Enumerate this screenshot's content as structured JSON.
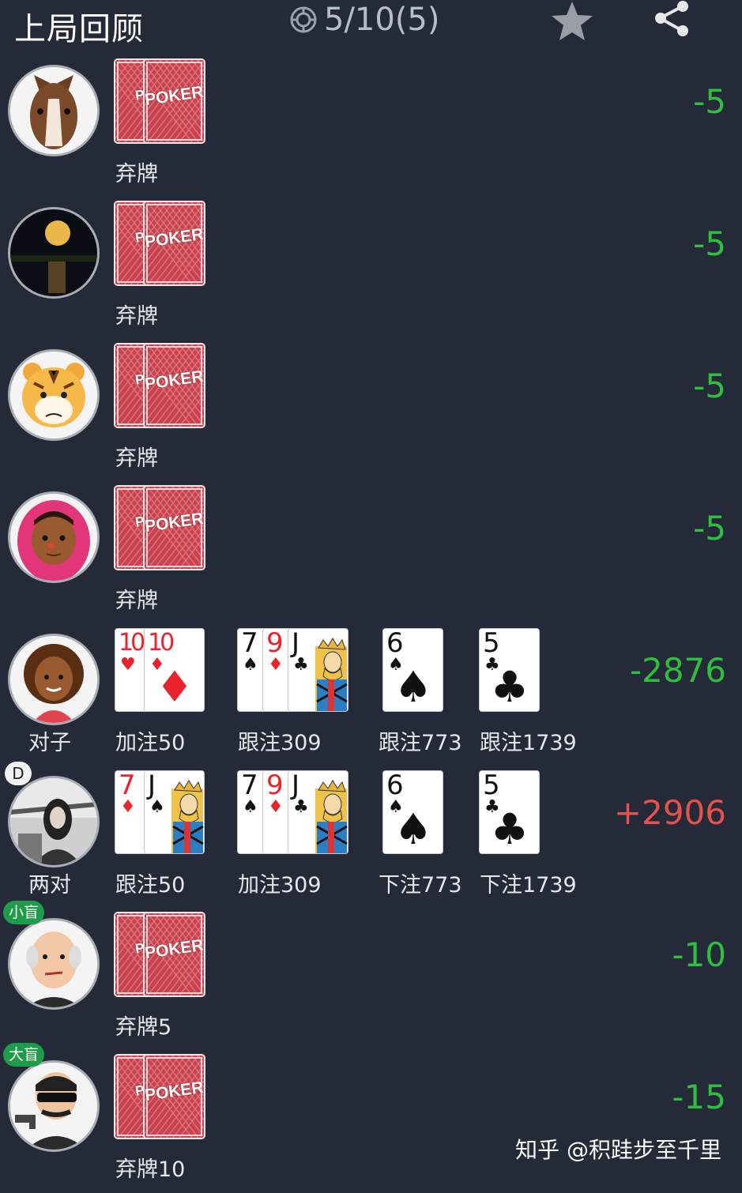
{
  "header": {
    "title": "上局回顾",
    "stakes": "5/10(5)",
    "icons": {
      "chip": "chip-icon",
      "star": "star-icon",
      "share": "share-icon"
    }
  },
  "colors": {
    "background": "#242a38",
    "win": "#e5514b",
    "loss": "#2fbf3f",
    "badge_green": "#1e9c4a"
  },
  "card_back_text": {
    "small": "PO",
    "big": "POKER"
  },
  "players": [
    {
      "avatar": "horse-avatar",
      "badge": "",
      "hand": "",
      "result": "-5",
      "sign": "neg",
      "streets": [
        {
          "type": "back",
          "action": "弃牌"
        }
      ]
    },
    {
      "avatar": "moon-avatar",
      "badge": "",
      "hand": "",
      "result": "-5",
      "sign": "neg",
      "streets": [
        {
          "type": "back",
          "action": "弃牌"
        }
      ]
    },
    {
      "avatar": "tiger-avatar",
      "badge": "",
      "hand": "",
      "result": "-5",
      "sign": "neg",
      "streets": [
        {
          "type": "back",
          "action": "弃牌"
        }
      ]
    },
    {
      "avatar": "hijab-girl-avatar",
      "badge": "",
      "hand": "",
      "result": "-5",
      "sign": "neg",
      "streets": [
        {
          "type": "back",
          "action": "弃牌"
        }
      ]
    },
    {
      "avatar": "curly-woman-avatar",
      "badge": "",
      "hand": "对子",
      "result": "-2876",
      "sign": "neg",
      "streets": [
        {
          "type": "hole",
          "action": "加注50",
          "cards": [
            {
              "rank": "10",
              "suit": "♥",
              "color": "red"
            },
            {
              "rank": "10",
              "suit": "♦",
              "color": "red"
            }
          ]
        },
        {
          "type": "flop",
          "action": "跟注309",
          "cards": [
            {
              "rank": "7",
              "suit": "♠",
              "color": "black"
            },
            {
              "rank": "9",
              "suit": "♦",
              "color": "red"
            },
            {
              "rank": "J",
              "suit": "♣",
              "color": "black"
            }
          ]
        },
        {
          "type": "turn",
          "action": "跟注773",
          "cards": [
            {
              "rank": "6",
              "suit": "♠",
              "color": "black"
            }
          ]
        },
        {
          "type": "river",
          "action": "跟注1739",
          "cards": [
            {
              "rank": "5",
              "suit": "♣",
              "color": "black"
            }
          ]
        }
      ]
    },
    {
      "avatar": "photo-woman-avatar",
      "badge": "D",
      "hand": "两对",
      "result": "+2906",
      "sign": "pos",
      "streets": [
        {
          "type": "hole",
          "action": "跟注50",
          "cards": [
            {
              "rank": "7",
              "suit": "♦",
              "color": "red"
            },
            {
              "rank": "J",
              "suit": "♠",
              "color": "black"
            }
          ]
        },
        {
          "type": "flop",
          "action": "加注309",
          "cards": [
            {
              "rank": "7",
              "suit": "♠",
              "color": "black"
            },
            {
              "rank": "9",
              "suit": "♦",
              "color": "red"
            },
            {
              "rank": "J",
              "suit": "♣",
              "color": "black"
            }
          ]
        },
        {
          "type": "turn",
          "action": "下注773",
          "cards": [
            {
              "rank": "6",
              "suit": "♠",
              "color": "black"
            }
          ]
        },
        {
          "type": "river",
          "action": "下注1739",
          "cards": [
            {
              "rank": "5",
              "suit": "♣",
              "color": "black"
            }
          ]
        }
      ]
    },
    {
      "avatar": "old-man-avatar",
      "badge": "小盲",
      "hand": "",
      "result": "-10",
      "sign": "neg",
      "streets": [
        {
          "type": "back",
          "action": "弃牌5"
        }
      ]
    },
    {
      "avatar": "gangster-avatar",
      "badge": "大盲",
      "hand": "",
      "result": "-15",
      "sign": "neg",
      "streets": [
        {
          "type": "back",
          "action": "弃牌10"
        }
      ]
    }
  ],
  "watermark": "知乎 @积跬步至千里"
}
